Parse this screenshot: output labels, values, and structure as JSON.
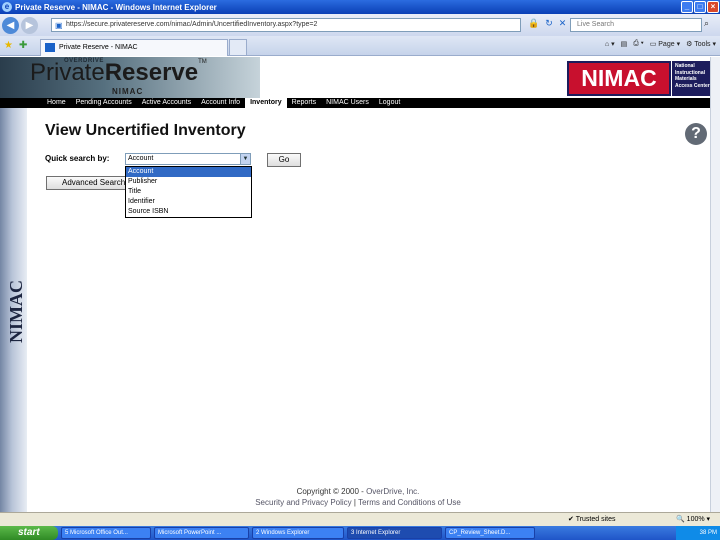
{
  "browser": {
    "title": "Private Reserve - NIMAC - Windows Internet Explorer",
    "url": "https://secure.privatereserve.com/nimac/Admin/UncertifiedInventory.aspx?type=2",
    "search_placeholder": "Live Search",
    "tab_title": "Private Reserve - NIMAC",
    "cmd": {
      "page": "Page",
      "tools": "Tools"
    },
    "status_zone": "Trusted sites",
    "status_zoom": "100%"
  },
  "header": {
    "logo_over": "OVERDRIVE",
    "logo_private": "Private",
    "logo_reserve": "Reserve",
    "logo_tm": "TM",
    "logo_sub": "NIMAC",
    "nimac_logo": "NIMAC",
    "nimac_desc": "National Instructional Materials Access Center"
  },
  "nav": {
    "items": [
      "Home",
      "Pending Accounts",
      "Active Accounts",
      "Account Info",
      "Inventory",
      "Reports",
      "NIMAC Users",
      "Logout"
    ],
    "active_index": 4
  },
  "sidebar": {
    "label": "NIMAC"
  },
  "main": {
    "title": "View Uncertified Inventory",
    "quick_search_label": "Quick search by:",
    "quick_search_value": "Account",
    "go_label": "Go",
    "advanced_label": "Advanced Search",
    "options": [
      "Account",
      "Publisher",
      "Title",
      "Identifier",
      "Source ISBN"
    ],
    "selected_option": "Account"
  },
  "footer": {
    "copyright": "Copyright © 2000 - ",
    "company": "OverDrive, Inc.",
    "privacy": "Security and Privacy Policy",
    "sep": "|",
    "terms": "Terms and Conditions of Use"
  },
  "taskbar": {
    "start": "start",
    "tasks": [
      "5 Microsoft Office Out...",
      "Microsoft PowerPoint ...",
      "2 Windows Explorer",
      "3 Internet Explorer",
      "CP_Review_Sheet.D..."
    ],
    "active_index": 3,
    "clock": "38 PM"
  }
}
